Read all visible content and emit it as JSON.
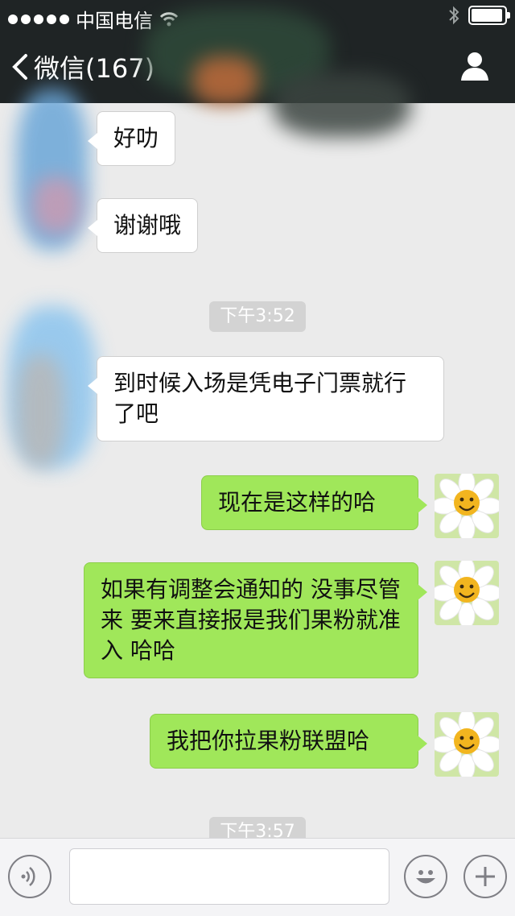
{
  "status_bar": {
    "carrier": "中国电信",
    "icons": [
      "signal-dots-icon",
      "wifi-icon",
      "bluetooth-icon",
      "battery-icon"
    ]
  },
  "nav": {
    "back_label": "微信(167)",
    "icons": [
      "chevron-left-icon",
      "profile-icon"
    ]
  },
  "messages": [
    {
      "side": "left",
      "text": "好叻"
    },
    {
      "side": "left",
      "text": "谢谢哦"
    },
    {
      "type": "time",
      "text": "下午3:52"
    },
    {
      "side": "left",
      "text": "到时候入场是凭电子门票就行了吧"
    },
    {
      "side": "right",
      "text": "现在是这样的哈"
    },
    {
      "side": "right",
      "text": "如果有调整会通知的 没事尽管来  要来直接报是我们果粉就准入 哈哈"
    },
    {
      "side": "right",
      "text": "我把你拉果粉联盟哈"
    },
    {
      "type": "time",
      "text": "下午3:57"
    }
  ],
  "input": {
    "placeholder": "",
    "icons": [
      "voice-icon",
      "emoji-icon",
      "plus-icon"
    ]
  },
  "colors": {
    "bar_bg": "#1f2425",
    "chat_bg": "#ebebeb",
    "right_bubble": "#a0e75a",
    "left_bubble": "#ffffff"
  }
}
